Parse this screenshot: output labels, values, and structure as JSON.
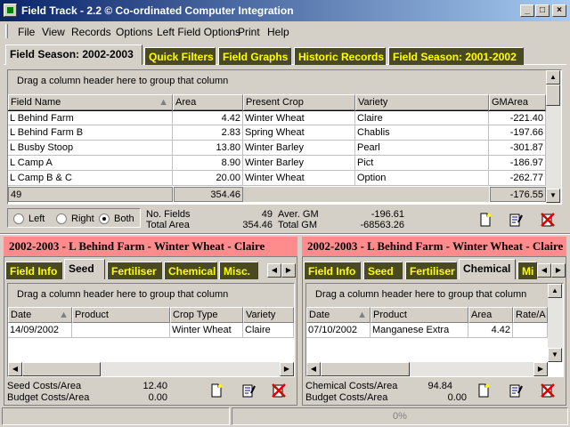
{
  "window": {
    "title": "Field Track - 2.2 © Co-ordinated Computer Integration"
  },
  "menu": [
    "File",
    "View",
    "Records",
    "Options",
    "Left Field Options",
    "Print",
    "Help"
  ],
  "top_tabs": [
    "Field Season: 2002-2003",
    "Quick Filters",
    "Field Graphs",
    "Historic Records",
    "Field Season: 2001-2002"
  ],
  "group_hint": "Drag a column header here to group that column",
  "fields_grid": {
    "columns": [
      "Field Name",
      "Area",
      "Present Crop",
      "Variety",
      "GMArea"
    ],
    "rows": [
      [
        "L Behind Farm",
        "4.42",
        "Winter Wheat",
        "Claire",
        "-221.40"
      ],
      [
        "L Behind Farm B",
        "2.83",
        "Spring Wheat",
        "Chablis",
        "-197.66"
      ],
      [
        "L Busby Stoop",
        "13.80",
        "Winter Barley",
        "Pearl",
        "-301.87"
      ],
      [
        "L Camp A",
        "8.90",
        "Winter Barley",
        "Pict",
        "-186.97"
      ],
      [
        "L Camp B & C",
        "20.00",
        "Winter Wheat",
        "Option",
        "-262.77"
      ]
    ],
    "footer": {
      "count": "49",
      "area": "354.46",
      "gm": "-176.55"
    }
  },
  "filter": {
    "options": [
      "Left",
      "Right",
      "Both"
    ],
    "selected": "Both"
  },
  "summary": {
    "no_fields_label": "No. Fields",
    "no_fields": "49",
    "total_area_label": "Total Area",
    "total_area": "354.46",
    "aver_gm_label": "Aver. GM",
    "aver_gm": "-196.61",
    "total_gm_label": "Total GM",
    "total_gm": "-68563.26"
  },
  "left_panel": {
    "header": "2002-2003 - L Behind Farm - Winter Wheat - Claire",
    "tabs": [
      "Field Info",
      "Seed",
      "Fertiliser",
      "Chemical",
      "Misc."
    ],
    "active_tab": "Seed",
    "columns": [
      "Date",
      "Product",
      "Crop Type",
      "Variety"
    ],
    "rows": [
      [
        "14/09/2002",
        "",
        "Winter Wheat",
        "Claire"
      ]
    ],
    "cost_label": "Seed Costs/Area",
    "cost": "12.40",
    "budget_label": "Budget Costs/Area",
    "budget": "0.00"
  },
  "right_panel": {
    "header": "2002-2003 - L Behind Farm - Winter Wheat - Claire",
    "tabs": [
      "Field Info",
      "Seed",
      "Fertiliser",
      "Chemical",
      "Mi"
    ],
    "active_tab": "Chemical",
    "columns": [
      "Date",
      "Product",
      "Area",
      "Rate/A"
    ],
    "rows": [
      [
        "07/10/2002",
        "Manganese Extra",
        "4.42",
        ""
      ]
    ],
    "cost_label": "Chemical Costs/Area",
    "cost": "94.84",
    "budget_label": "Budget Costs/Area",
    "budget": "0.00"
  },
  "statusbar": {
    "progress": "0%"
  },
  "icons": [
    "new-record-icon",
    "edit-record-icon",
    "delete-record-icon"
  ]
}
